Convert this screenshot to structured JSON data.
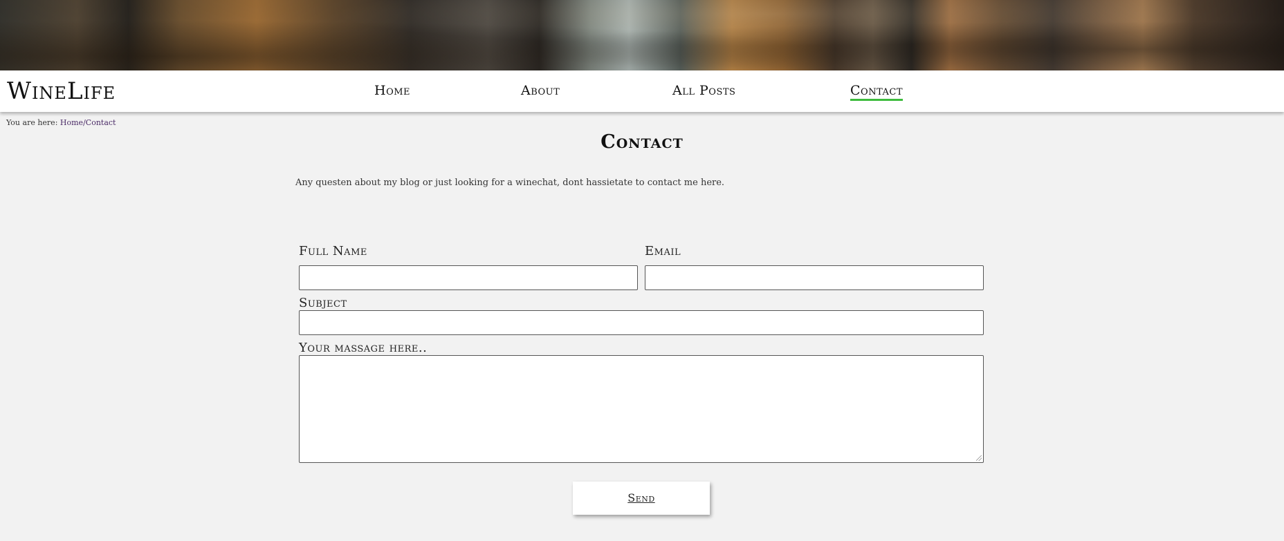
{
  "hero": {
    "image_name": "wine-barrels-photo"
  },
  "header": {
    "logo": "WineLife",
    "nav": [
      {
        "label": "Home"
      },
      {
        "label": "About"
      },
      {
        "label": "All Posts"
      },
      {
        "label": "Contact",
        "active": true
      }
    ],
    "active_underline_color": "#3dbb3d"
  },
  "breadcrumb": {
    "prefix": "You are here:",
    "home": "Home",
    "separator": "/",
    "current": "Contact"
  },
  "page": {
    "title": "Contact",
    "intro": "Any questen about my blog or just looking for a winechat, dont hassietate to contact me here."
  },
  "form": {
    "full_name_label": "Full Name",
    "full_name_value": "",
    "email_label": "Email",
    "email_value": "",
    "subject_label": "Subject",
    "subject_value": "",
    "message_label": "Your massage here..",
    "message_value": "",
    "send_label": "Send"
  }
}
